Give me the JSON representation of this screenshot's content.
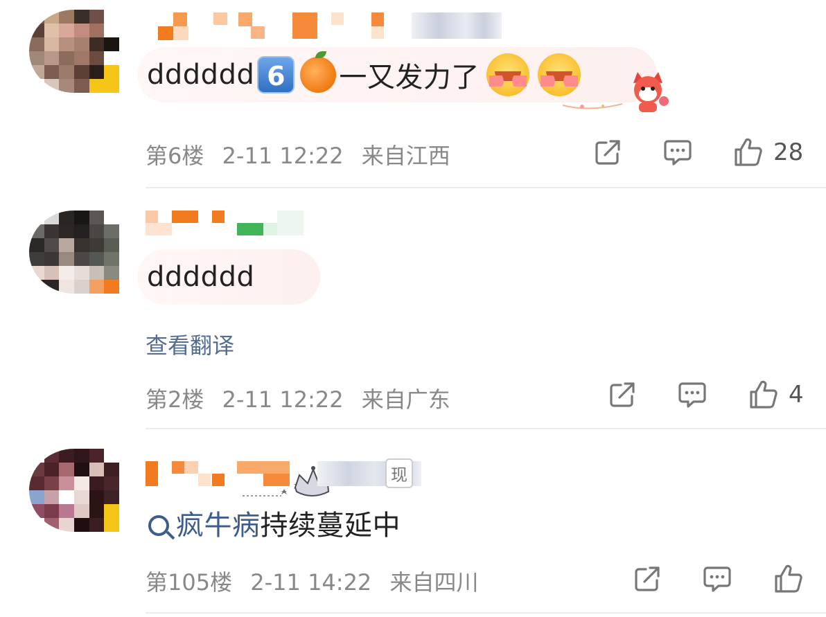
{
  "comments": [
    {
      "text": "dddddd",
      "topic_text": "一又发力了",
      "keycap": "6",
      "floor": "第6楼",
      "time": "2-11 12:22",
      "location": "来自江西",
      "likes": "28"
    },
    {
      "text": "dddddd",
      "translate_label": "查看翻译",
      "floor": "第2楼",
      "time": "2-11 12:22",
      "location": "来自广东",
      "likes": "4"
    },
    {
      "topic_link": "疯牛病",
      "topic_text": "持续蔓延中",
      "badge": "现",
      "floor": "第105楼",
      "time": "2-11 14:22",
      "location": "来自四川",
      "likes": ""
    }
  ],
  "icons": {
    "share": "share-icon",
    "comment": "comment-icon",
    "like": "thumbs-up-icon",
    "search": "search-icon"
  },
  "colors": {
    "meta": "#888888",
    "link": "#3f5d8c",
    "divider": "#ebebeb"
  }
}
